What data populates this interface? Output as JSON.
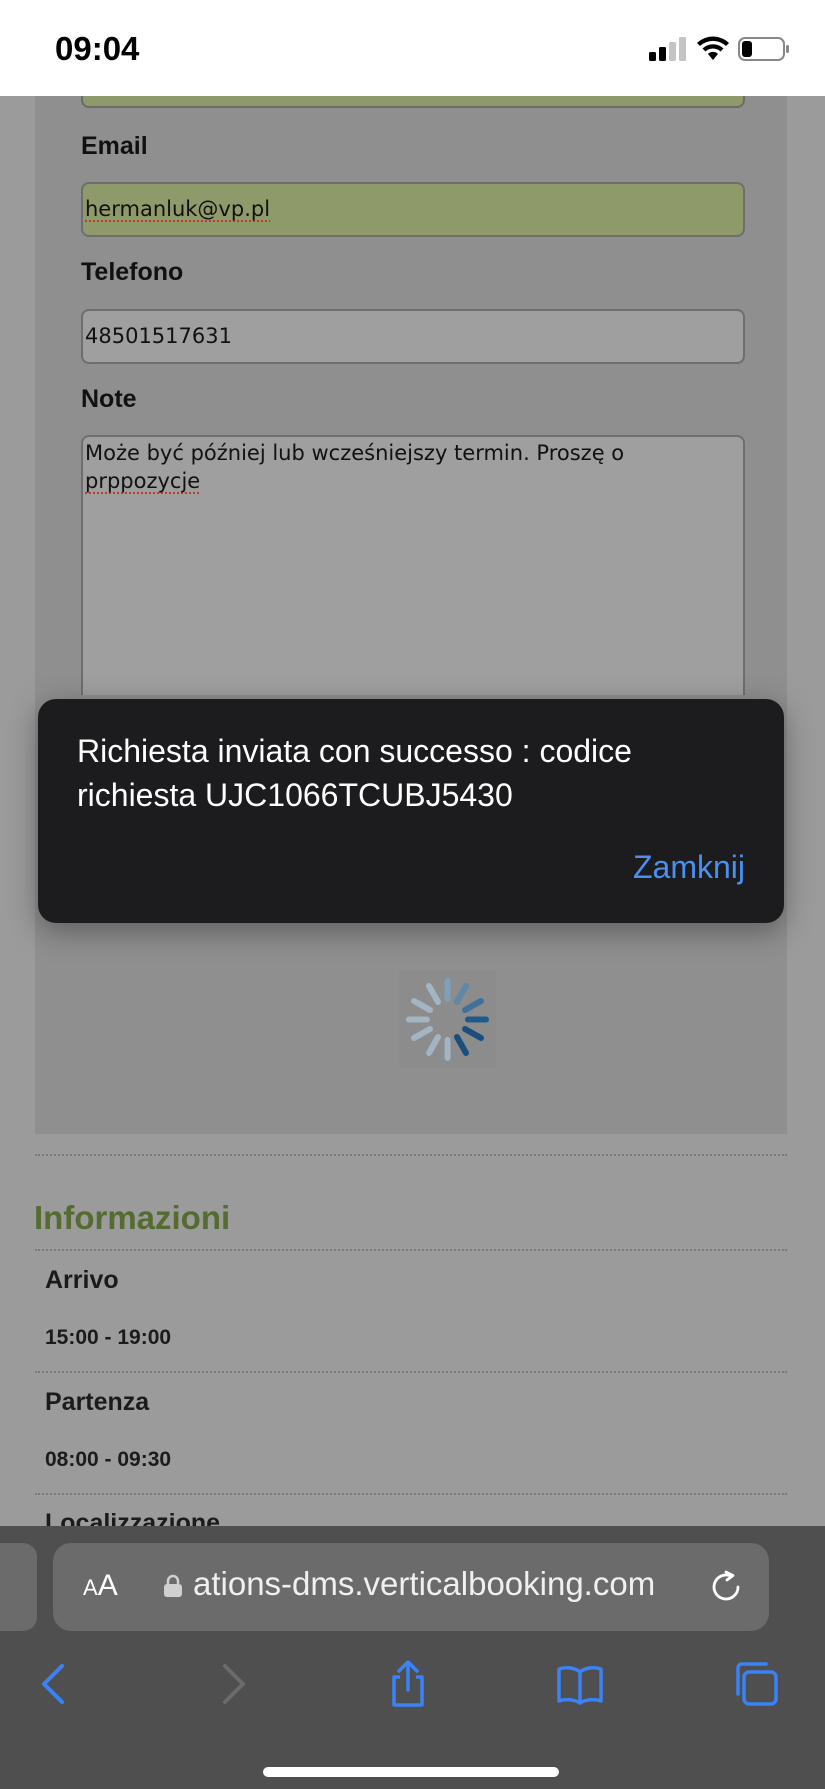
{
  "status_bar": {
    "time": "09:04"
  },
  "form": {
    "email_label": "Email",
    "email_value": "hermanluk@vp.pl",
    "phone_label": "Telefono",
    "phone_value": "48501517631",
    "note_label": "Note",
    "note_value_line1": "Może być później lub wcześniejszy termin. Proszę o",
    "note_value_line2": "prppozycje"
  },
  "alert": {
    "message": "Richiesta inviata con successo : codice richiesta UJC1066TCUBJ5430",
    "button_label": "Zamknij"
  },
  "info": {
    "title": "Informazioni",
    "arrival_label": "Arrivo",
    "arrival_time": "15:00 - 19:00",
    "departure_label": "Partenza",
    "departure_time": "08:00 - 09:30",
    "location_label": "Localizzazione"
  },
  "safari": {
    "text_size_label": "AA",
    "url": "ations-dms.verticalbooking.com"
  },
  "colors": {
    "accent_blue": "#4a90f0",
    "section_green": "#556b2f",
    "field_highlight": "#8f9a6a",
    "alert_bg": "#1c1c1e"
  },
  "icons": [
    "signal-icon",
    "wifi-icon",
    "battery-icon",
    "lock-icon",
    "reload-icon",
    "back-icon",
    "forward-icon",
    "share-icon",
    "bookmarks-icon",
    "tabs-icon",
    "spinner-icon"
  ]
}
